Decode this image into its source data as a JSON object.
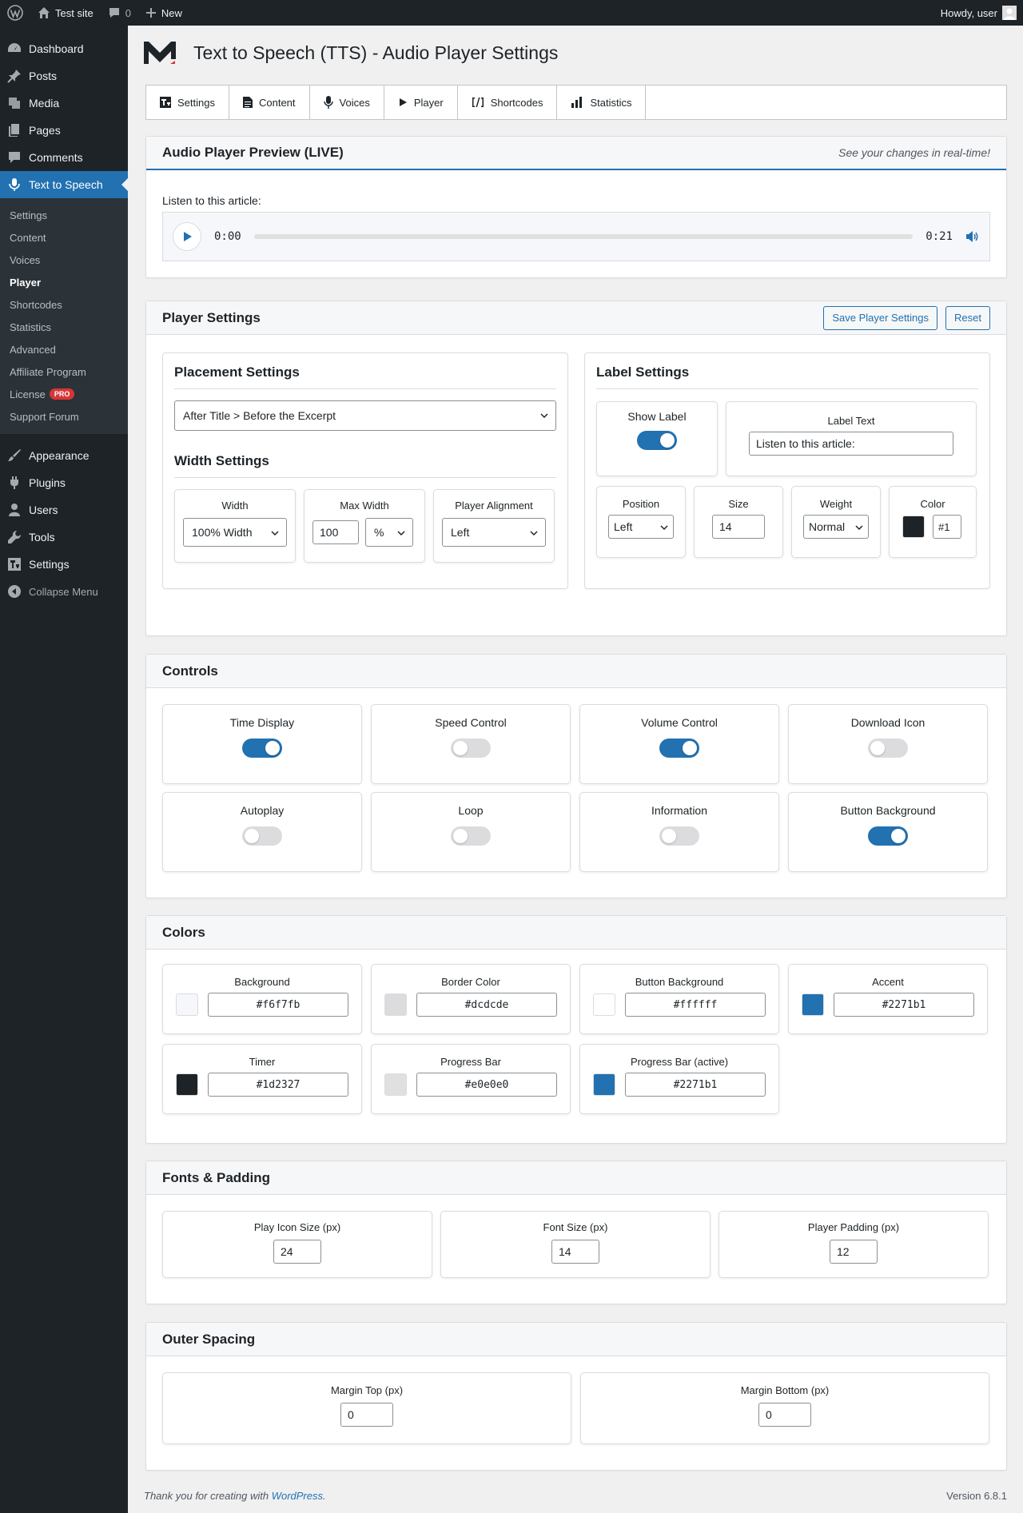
{
  "adminbar": {
    "site_name": "Test site",
    "comments_count": "0",
    "new_label": "New",
    "howdy": "Howdy, user"
  },
  "sidebar": {
    "items": [
      {
        "label": "Dashboard",
        "icon": "dashboard-icon"
      },
      {
        "label": "Posts",
        "icon": "pin-icon"
      },
      {
        "label": "Media",
        "icon": "media-icon"
      },
      {
        "label": "Pages",
        "icon": "pages-icon"
      },
      {
        "label": "Comments",
        "icon": "comment-icon"
      },
      {
        "label": "Text to Speech",
        "icon": "microphone-icon"
      }
    ],
    "submenu": [
      "Settings",
      "Content",
      "Voices",
      "Player",
      "Shortcodes",
      "Statistics",
      "Advanced",
      "Affiliate Program",
      "License",
      "Support Forum"
    ],
    "pro_badge": "PRO",
    "items2": [
      {
        "label": "Appearance",
        "icon": "brush-icon"
      },
      {
        "label": "Plugins",
        "icon": "plugin-icon"
      },
      {
        "label": "Users",
        "icon": "users-icon"
      },
      {
        "label": "Tools",
        "icon": "wrench-icon"
      },
      {
        "label": "Settings",
        "icon": "settings-icon"
      }
    ],
    "collapse": "Collapse Menu"
  },
  "page": {
    "title": "Text to Speech (TTS) - Audio Player Settings"
  },
  "tabs": [
    "Settings",
    "Content",
    "Voices",
    "Player",
    "Shortcodes",
    "Statistics"
  ],
  "preview": {
    "title": "Audio Player Preview (LIVE)",
    "note": "See your changes in real-time!",
    "label": "Listen to this article:",
    "time_current": "0:00",
    "time_total": "0:21",
    "progress": 0
  },
  "player_settings": {
    "title": "Player Settings",
    "save_label": "Save Player Settings",
    "reset_label": "Reset",
    "placement": {
      "title": "Placement Settings",
      "value": "After Title > Before the Excerpt"
    },
    "width": {
      "title": "Width Settings",
      "width_label": "Width",
      "width_value": "100% Width",
      "max_label": "Max Width",
      "max_value": "100",
      "max_unit": "%",
      "align_label": "Player Alignment",
      "align_value": "Left"
    },
    "label": {
      "title": "Label Settings",
      "show_label": "Show Label",
      "show_on": true,
      "text_label": "Label Text",
      "text_value": "Listen to this article:",
      "position_label": "Position",
      "position_value": "Left",
      "size_label": "Size",
      "size_value": "14",
      "weight_label": "Weight",
      "weight_value": "Normal",
      "color_label": "Color",
      "color_value": "#1",
      "color_swatch": "#1d2327"
    }
  },
  "controls": {
    "title": "Controls",
    "items": [
      {
        "label": "Time Display",
        "on": true
      },
      {
        "label": "Speed Control",
        "on": false
      },
      {
        "label": "Volume Control",
        "on": true
      },
      {
        "label": "Download Icon",
        "on": false
      },
      {
        "label": "Autoplay",
        "on": false
      },
      {
        "label": "Loop",
        "on": false
      },
      {
        "label": "Information",
        "on": false
      },
      {
        "label": "Button Background",
        "on": true
      }
    ]
  },
  "colors": {
    "title": "Colors",
    "items": [
      {
        "label": "Background",
        "value": "#f6f7fb"
      },
      {
        "label": "Border Color",
        "value": "#dcdcde"
      },
      {
        "label": "Button Background",
        "value": "#ffffff"
      },
      {
        "label": "Accent",
        "value": "#2271b1"
      },
      {
        "label": "Timer",
        "value": "#1d2327"
      },
      {
        "label": "Progress Bar",
        "value": "#e0e0e0"
      },
      {
        "label": "Progress Bar (active)",
        "value": "#2271b1"
      }
    ]
  },
  "fonts": {
    "title": "Fonts & Padding",
    "items": [
      {
        "label": "Play Icon Size (px)",
        "value": "24"
      },
      {
        "label": "Font Size (px)",
        "value": "14"
      },
      {
        "label": "Player Padding (px)",
        "value": "12"
      }
    ]
  },
  "spacing": {
    "title": "Outer Spacing",
    "items": [
      {
        "label": "Margin Top (px)",
        "value": "0"
      },
      {
        "label": "Margin Bottom (px)",
        "value": "0"
      }
    ]
  },
  "footer": {
    "text": "Thank you for creating with ",
    "link": "WordPress",
    "period": ".",
    "version": "Version 6.8.1"
  }
}
